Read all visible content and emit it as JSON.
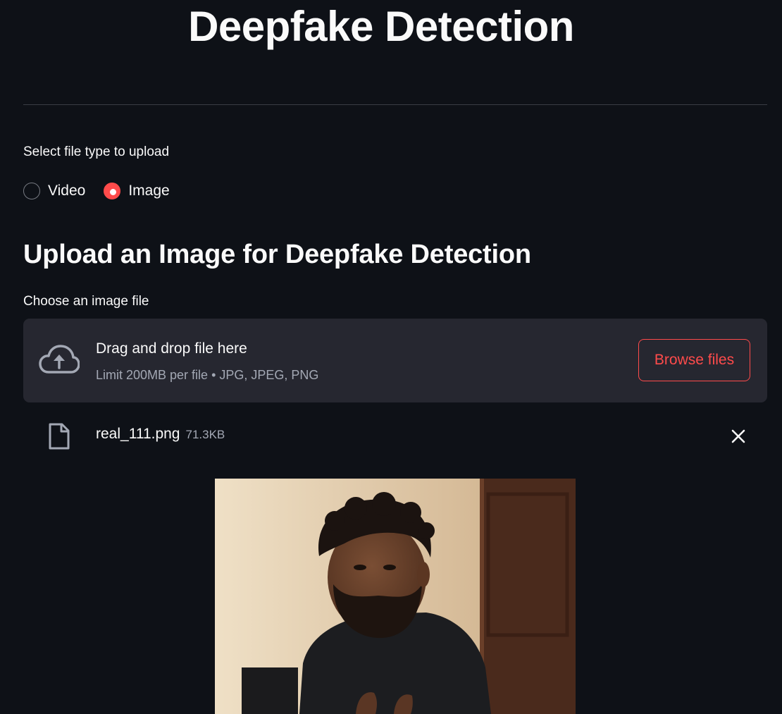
{
  "header": {
    "title": "Deepfake Detection"
  },
  "file_type": {
    "label": "Select file type to upload",
    "options": [
      "Video",
      "Image"
    ],
    "selected": "Image"
  },
  "upload_section": {
    "heading": "Upload an Image for Deepfake Detection",
    "label": "Choose an image file",
    "dropzone": {
      "title": "Drag and drop file here",
      "subtitle": "Limit 200MB per file • JPG, JPEG, PNG",
      "icon": "cloud-upload-icon",
      "browse_label": "Browse files"
    },
    "uploaded_file": {
      "name": "real_111.png",
      "size": "71.3KB",
      "icon": "file-icon",
      "remove_icon": "close-icon"
    }
  },
  "preview": {
    "description_icon": "image-preview"
  },
  "colors": {
    "background": "#0e1117",
    "accent": "#ff4b4b",
    "dropzone_bg": "#262730",
    "muted_text": "#a3a8b4"
  }
}
